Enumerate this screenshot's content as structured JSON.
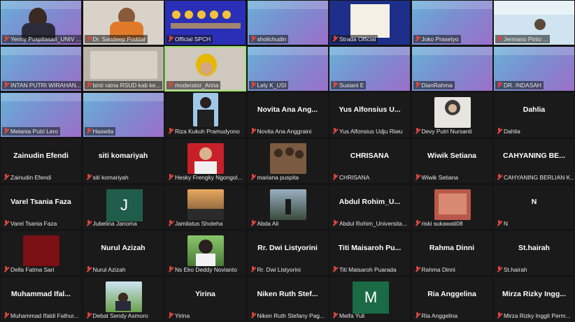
{
  "tiles": [
    {
      "name": "Yenny Puspitasari_UNIV ..."
    },
    {
      "name": "Dr. Sandeep Poddar"
    },
    {
      "name": "Official SPCH"
    },
    {
      "name": "sholichudin"
    },
    {
      "name": "Strada Official"
    },
    {
      "name": "Joko Prasetyo"
    },
    {
      "name": "Jermano Pinto ..."
    },
    {
      "name": "INTAN PUTRI WIRAHAN..."
    },
    {
      "name": "binti ratna RSUD kab ke..."
    },
    {
      "name": "moderator_Arina"
    },
    {
      "name": "Lely K_USI"
    },
    {
      "name": "Susiani E"
    },
    {
      "name": "DianRahma"
    },
    {
      "name": "DR. INDASAH"
    },
    {
      "name": "Melania Putri Lero"
    },
    {
      "name": "Haswita"
    },
    {
      "name": "Riza Kukuh Pramudyono"
    },
    {
      "big": "Novita Ana Ang...",
      "name": "Novita Ana Anggraini"
    },
    {
      "big": "Yus Alfonsius U...",
      "name": "Yus Alfonsius Udju Riwu"
    },
    {
      "name": "Devy Putri Nursanti"
    },
    {
      "big": "Dahlia",
      "name": "Dahlia"
    },
    {
      "big": "Zainudin Efendi",
      "name": "Zainudin Efendi"
    },
    {
      "big": "siti komariyah",
      "name": "siti komariyah"
    },
    {
      "name": "Hesky Frengky Ngongol..."
    },
    {
      "name": "mariana puspita"
    },
    {
      "big": "CHRISANA",
      "name": "CHRISANA"
    },
    {
      "big": "Wiwik Setiana",
      "name": "Wiwik Setiana"
    },
    {
      "big": "CAHYANING BE...",
      "name": "CAHYANING BERLIAN K..."
    },
    {
      "big": "Varel Tsania Faza",
      "name": "Varel Tsania Faza"
    },
    {
      "avatar": "J",
      "name": "Jubelina Janoma"
    },
    {
      "name": "Jamilatus Sholeha"
    },
    {
      "name": "Abda Ali"
    },
    {
      "big": "Abdul Rohim_U...",
      "name": "Abdul Rohim_Universita..."
    },
    {
      "name": "riski sukawati08"
    },
    {
      "big": "N",
      "name": "N"
    },
    {
      "name": "Della Fatma Sari"
    },
    {
      "big": "Nurul Azizah",
      "name": "Nurul Azizah"
    },
    {
      "name": "Ns Eko Deddy Novianto"
    },
    {
      "big": "Rr. Dwi Listyorini",
      "name": "Rr. Dwi Listyorini"
    },
    {
      "big": "Titi Maisaroh Pu...",
      "name": "Titi Maisaroh Puarada"
    },
    {
      "big": "Rahma Dinni",
      "name": "Rahma Dinni"
    },
    {
      "big": "St.hairah",
      "name": "St.hairah"
    },
    {
      "big": "Muhammad Ifal...",
      "name": "Muhammad Ifaldi Fathur..."
    },
    {
      "name": "Debat Sendy Asmoro"
    },
    {
      "big": "Yirina",
      "name": "Yirina"
    },
    {
      "big": "Niken Ruth Stef...",
      "name": "Niken Ruth Stefany Pag..."
    },
    {
      "avatar": "M",
      "name": "Meifa Yuli"
    },
    {
      "big": "Ria Anggelina",
      "name": "Ria Anggelina"
    },
    {
      "big": "Mirza Rizky Ingg...",
      "name": "Mirza Rizky Inggit Perm..."
    }
  ]
}
